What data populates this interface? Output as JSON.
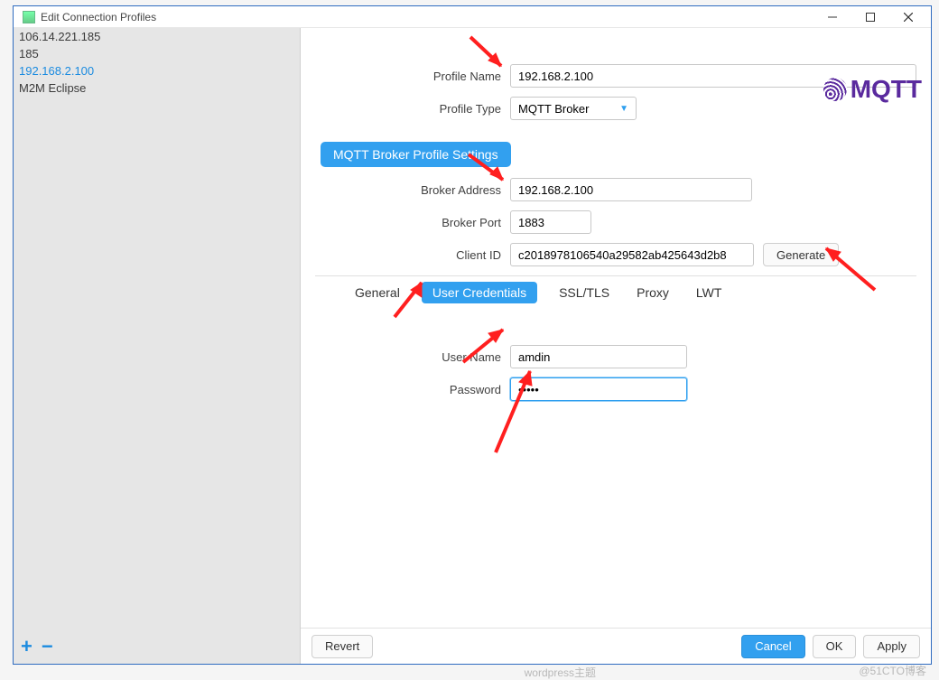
{
  "window": {
    "title": "Edit Connection Profiles"
  },
  "sidebar": {
    "profiles": [
      {
        "label": "106.14.221.185"
      },
      {
        "label": "185"
      },
      {
        "label": "192.168.2.100",
        "selected": true
      },
      {
        "label": "M2M Eclipse"
      }
    ]
  },
  "form": {
    "profile_name_label": "Profile Name",
    "profile_name_value": "192.168.2.100",
    "profile_type_label": "Profile Type",
    "profile_type_value": "MQTT Broker",
    "section_label": "MQTT Broker Profile Settings",
    "broker_addr_label": "Broker Address",
    "broker_addr_value": "192.168.2.100",
    "broker_port_label": "Broker Port",
    "broker_port_value": "1883",
    "client_id_label": "Client ID",
    "client_id_value": "c2018978106540a29582ab425643d2b8",
    "generate_label": "Generate"
  },
  "tabs": {
    "general": "General",
    "user_credentials": "User Credentials",
    "ssl_tls": "SSL/TLS",
    "proxy": "Proxy",
    "lwt": "LWT"
  },
  "credentials": {
    "user_label": "User Name",
    "user_value": "amdin",
    "password_label": "Password",
    "password_value": "•••••"
  },
  "footer": {
    "revert": "Revert",
    "cancel": "Cancel",
    "ok": "OK",
    "apply": "Apply"
  },
  "logo_text": "MQTT",
  "watermark": "@51CTO博客",
  "watermark2": "wordpress主题"
}
